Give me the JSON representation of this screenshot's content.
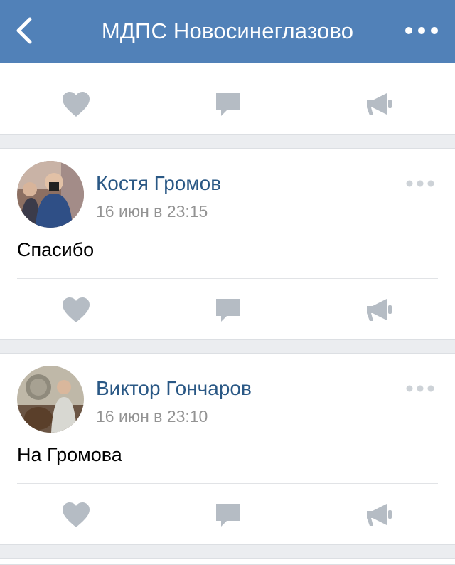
{
  "navbar": {
    "title": "МДПС Новосинеглазово",
    "back_icon": "chevron-left-icon",
    "more_icon": "more-horizontal-icon"
  },
  "colors": {
    "header": "#5181b8",
    "author_link": "#2a5885",
    "meta": "#939393",
    "icon": "#b5bcc4",
    "background": "#ebedf0"
  },
  "posts": [
    {
      "author": "Костя Громов",
      "time": "16 июн в 23:15",
      "text": "Спасибо"
    },
    {
      "author": "Виктор Гончаров",
      "time": "16 июн в 23:10",
      "text": "На Громова"
    }
  ],
  "action_icons": [
    "heart-icon",
    "comment-icon",
    "megaphone-icon"
  ]
}
